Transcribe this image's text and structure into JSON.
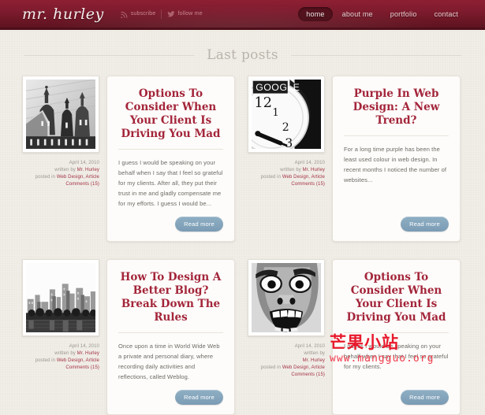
{
  "site": {
    "logo": "mr. hurley",
    "social": [
      {
        "label": "subscribe",
        "icon": "rss-icon"
      },
      {
        "label": "follow me",
        "icon": "twitter-icon"
      }
    ],
    "nav": [
      {
        "label": "home",
        "active": true
      },
      {
        "label": "about me",
        "active": false
      },
      {
        "label": "portfolio",
        "active": false
      },
      {
        "label": "contact",
        "active": false
      }
    ]
  },
  "main": {
    "section_title": "Last posts",
    "read_more_label": "Read more",
    "posts": [
      {
        "title": "Options To Consider When Your Client Is Driving You Mad",
        "excerpt": "I guess I would be speaking on your behalf when I say that I feel so grateful for my clients. After all, they put their trust in me and gladly compensate me for my efforts. I guess I would be...",
        "date": "April 14, 2010",
        "written_by_label": "written by",
        "author": "Mr. Hurley",
        "posted_in_label": "posted in",
        "categories": "Web Design, Article",
        "comments": "Comments (15)",
        "thumb": "church-domes-photo"
      },
      {
        "title": "Purple In Web Design: A New Trend?",
        "excerpt": "For a long time purple has been the least used colour in web design. In recent months I noticed the number of websites...",
        "date": "April 14, 2010",
        "written_by_label": "written by",
        "author": "Mr. Hurley",
        "posted_in_label": "posted in",
        "categories": "Web Design, Article",
        "comments": "Comments (15)",
        "thumb": "google-clock-photo"
      },
      {
        "title": "How To Design A Better Blog? Break Down The Rules",
        "excerpt": "Once upon a time in World Wide Web a private and personal diary, where recording daily activities and reflections, called Weblog.",
        "date": "April 14, 2010",
        "written_by_label": "written by",
        "author": "Mr. Hurley",
        "posted_in_label": "posted in",
        "categories": "Web Design, Article",
        "comments": "Comments (15)",
        "thumb": "city-skyline-photo"
      },
      {
        "title": "Options To Consider When Your Client Is Driving You Mad",
        "excerpt": "I guess I would be speaking on your behalf when I say that I feel so grateful for my clients.",
        "date": "April 14, 2010",
        "written_by_label": "written by",
        "author": "Mr. Hurley",
        "posted_in_label": "posted in",
        "categories": "Web Design, Article",
        "comments": "Comments (15)",
        "thumb": "screaming-face-photo"
      }
    ]
  },
  "watermark": {
    "cn": "芒果小站",
    "url": "www.mangguo.org"
  },
  "colors": {
    "header_red": "#7d1b2d",
    "title_red": "#a3253a",
    "accent_blue": "#7a9cb4",
    "page_bg": "#f1eee8"
  },
  "thumb_label_google": "GOOGLE"
}
